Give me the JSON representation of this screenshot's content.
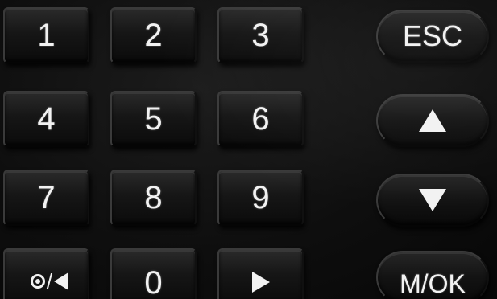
{
  "keypad": {
    "keys": {
      "k1": "1",
      "k2": "2",
      "k3": "3",
      "k4": "4",
      "k5": "5",
      "k6": "6",
      "k7": "7",
      "k8": "8",
      "k9": "9",
      "k0": "0"
    },
    "side": {
      "esc": "ESC",
      "ok": "M/OK"
    },
    "combo_slash": "/",
    "icons": {
      "up": "up-triangle-icon",
      "down": "down-triangle-icon",
      "right": "right-triangle-icon",
      "left": "left-triangle-icon",
      "power": "circle-dot-icon"
    },
    "colors": {
      "key_face": "#161616",
      "label": "#f2f2f2",
      "background": "#0b0b0b"
    }
  }
}
